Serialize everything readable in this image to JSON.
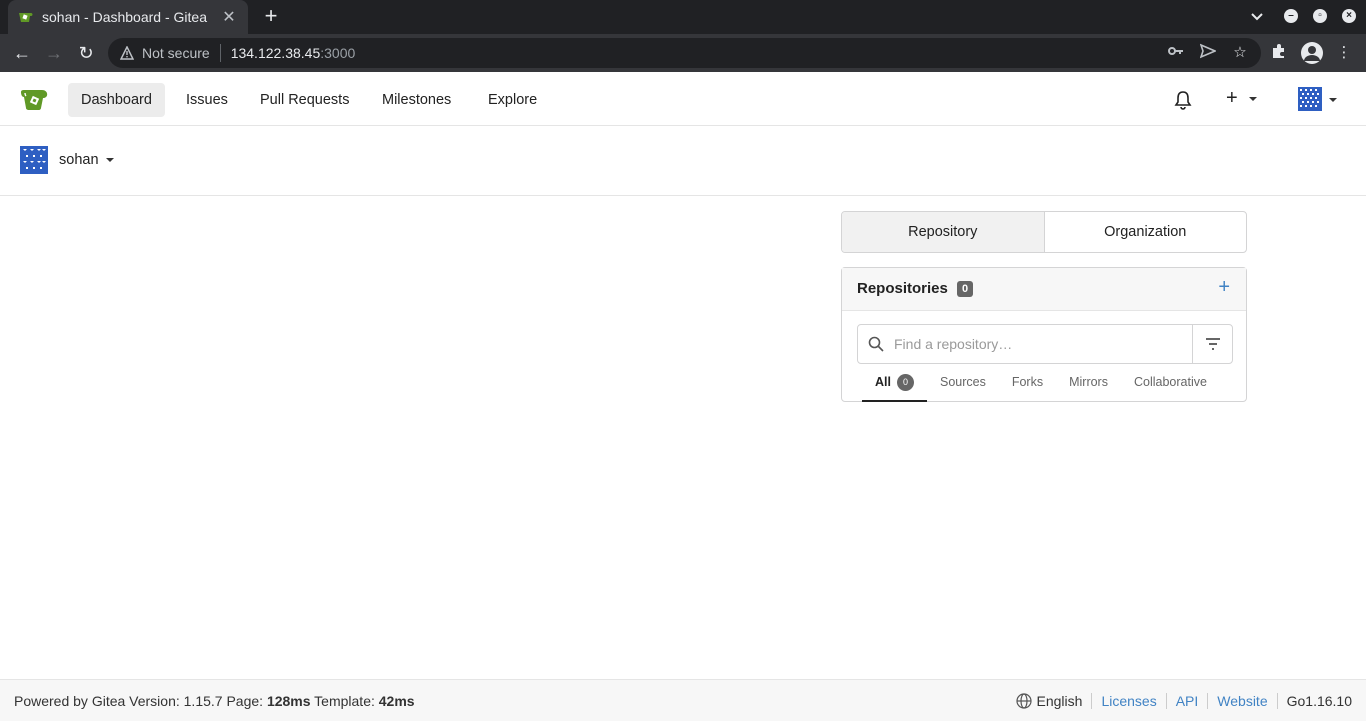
{
  "browser": {
    "tab_title": "sohan - Dashboard - Gitea",
    "tab_close": "✕",
    "new_tab": "+",
    "not_secure": "Not secure",
    "url_host": "134.122.38.45",
    "url_port": ":3000"
  },
  "navbar": {
    "items": [
      {
        "label": "Dashboard"
      },
      {
        "label": "Issues"
      },
      {
        "label": "Pull Requests"
      },
      {
        "label": "Milestones"
      },
      {
        "label": "Explore"
      }
    ],
    "plus": "+"
  },
  "context": {
    "user": "sohan"
  },
  "switcher": {
    "repository": "Repository",
    "organization": "Organization"
  },
  "repos": {
    "title": "Repositories",
    "count": "0",
    "add": "+",
    "search_placeholder": "Find a repository…",
    "tabs": [
      {
        "label": "All",
        "count": "0"
      },
      {
        "label": "Sources"
      },
      {
        "label": "Forks"
      },
      {
        "label": "Mirrors"
      },
      {
        "label": "Collaborative"
      }
    ]
  },
  "footer": {
    "powered": "Powered by Gitea Version: 1.15.7 Page:",
    "page_time": "128ms",
    "template_label": "Template:",
    "template_time": "42ms",
    "language": "English",
    "licenses": "Licenses",
    "api": "API",
    "website": "Website",
    "go_version": "Go1.16.10"
  },
  "colors": {
    "accent": "#4183c4",
    "gitea_green": "#609926",
    "chrome_dark": "#202124"
  }
}
